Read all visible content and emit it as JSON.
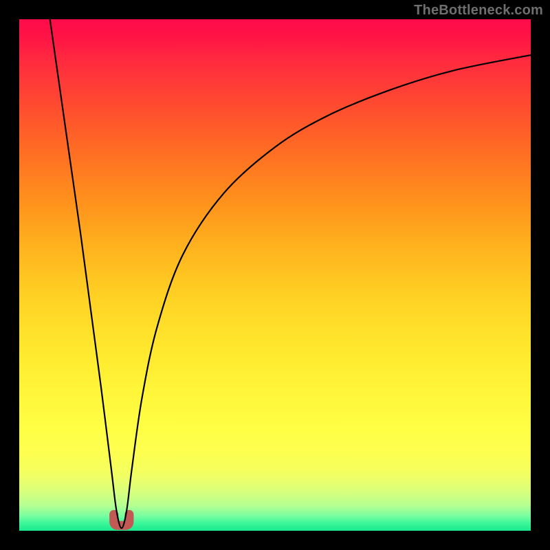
{
  "watermark": "TheBottleneck.com",
  "chart_data": {
    "type": "line",
    "title": "",
    "xlabel": "",
    "ylabel": "",
    "xlim": [
      0,
      100
    ],
    "ylim": [
      0,
      100
    ],
    "grid": false,
    "legend": false,
    "background": "vertical-gradient",
    "gradient_stops": [
      {
        "pos": 0,
        "color": "#ff0b4a"
      },
      {
        "pos": 35,
        "color": "#ff8f1c"
      },
      {
        "pos": 65,
        "color": "#ffe92e"
      },
      {
        "pos": 90,
        "color": "#dcff7a"
      },
      {
        "pos": 100,
        "color": "#19e98f"
      }
    ],
    "series": [
      {
        "name": "bottleneck-curve",
        "color": "#000000",
        "x": [
          6,
          8,
          10,
          12,
          14,
          16,
          18,
          19,
          20,
          21,
          22,
          24,
          27,
          32,
          40,
          50,
          60,
          72,
          85,
          100
        ],
        "y": [
          100,
          86,
          72,
          58,
          43,
          28,
          12,
          4,
          0.5,
          4,
          12,
          26,
          40,
          54,
          66,
          75,
          81,
          86,
          90,
          93
        ]
      }
    ],
    "marker": {
      "name": "dip-marker",
      "color": "#c15a54",
      "x_range": [
        18.5,
        21.5
      ],
      "y": 0.5
    }
  }
}
